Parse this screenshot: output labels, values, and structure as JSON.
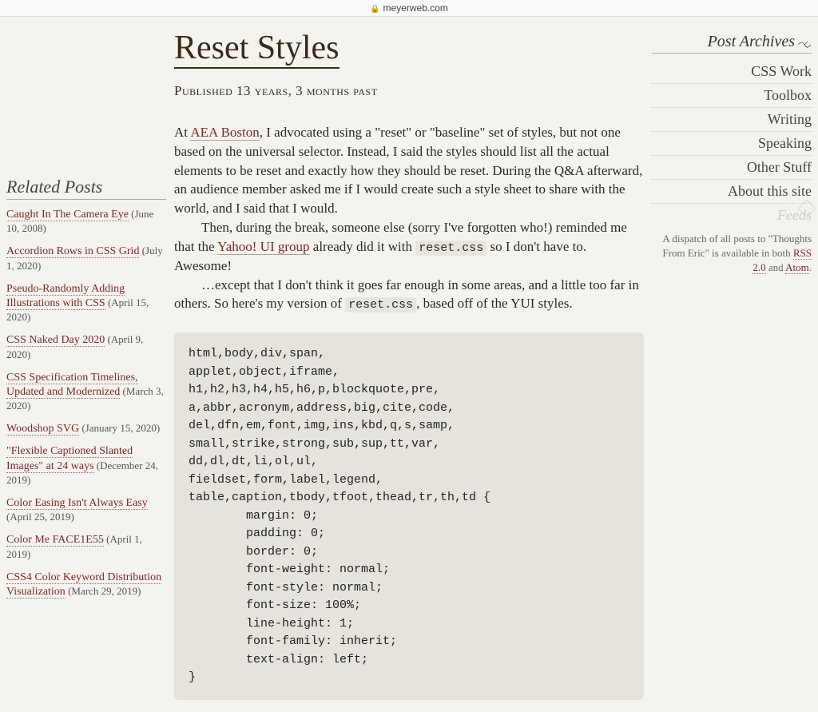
{
  "browser": {
    "host": "meyerweb.com"
  },
  "page": {
    "title": "Reset Styles",
    "published": "Published 13 years, 3 months past"
  },
  "body": {
    "p1_a": "At ",
    "p1_link": "AEA Boston",
    "p1_b": ", I advocated using a \"reset\" or \"baseline\" set of styles, but not one based on the universal selector.  Instead, I said the styles should list all the actual elements to be reset and exactly how they should be reset.  During the Q&A afterward, an audience member asked me if I would create such a style sheet to share with the world, and I said that I would.",
    "p2_a": "Then, during the break, someone else (sorry I've forgotten who!) reminded me that the ",
    "p2_link": "Yahoo! UI group",
    "p2_b": " already did it with ",
    "p2_code": "reset.css",
    "p2_c": " so I don't have to.  Awesome!",
    "p3_a": "…except that I don't think it goes far enough in some areas, and a little too far in others.  So here's my version of ",
    "p3_code": "reset.css",
    "p3_b": ", based off of the YUI styles."
  },
  "code": "html,body,div,span,\napplet,object,iframe,\nh1,h2,h3,h4,h5,h6,p,blockquote,pre,\na,abbr,acronym,address,big,cite,code,\ndel,dfn,em,font,img,ins,kbd,q,s,samp,\nsmall,strike,strong,sub,sup,tt,var,\ndd,dl,dt,li,ol,ul,\nfieldset,form,label,legend,\ntable,caption,tbody,tfoot,thead,tr,th,td {\n        margin: 0;\n        padding: 0;\n        border: 0;\n        font-weight: normal;\n        font-style: normal;\n        font-size: 100%;\n        line-height: 1;\n        font-family: inherit;\n        text-align: left;\n}",
  "related": {
    "heading": "Related Posts",
    "items": [
      {
        "title": "Caught In The Camera Eye",
        "date": "(June 10, 2008)"
      },
      {
        "title": "Accordion Rows in CSS Grid",
        "date": "(July 1, 2020)"
      },
      {
        "title": "Pseudo-Randomly Adding Illustrations with CSS",
        "date": "(April 15, 2020)"
      },
      {
        "title": "CSS Naked Day 2020",
        "date": "(April 9, 2020)"
      },
      {
        "title": "CSS Specification Timelines, Updated and Modernized",
        "date": "(March 3, 2020)"
      },
      {
        "title": "Woodshop SVG",
        "date": "(January 15, 2020)"
      },
      {
        "title": "\"Flexible Captioned Slanted Images\" at 24 ways",
        "date": "(December 24, 2019)"
      },
      {
        "title": "Color Easing Isn't Always Easy",
        "date": "(April 25, 2019)"
      },
      {
        "title": "Color Me FACE1E55",
        "date": "(April 1, 2019)"
      },
      {
        "title": "CSS4 Color Keyword Distribution Visualization",
        "date": "(March 29, 2019)"
      }
    ]
  },
  "nav": {
    "heading": "Post Archives",
    "items": [
      "CSS Work",
      "Toolbox",
      "Writing",
      "Speaking",
      "Other Stuff",
      "About this site"
    ],
    "feeds_label": "Feeds",
    "dispatch_a": "A dispatch of all posts to \"Thoughts From Eric\" is available in both ",
    "rss": "RSS 2.0",
    "dispatch_b": " and ",
    "atom": "Atom",
    "dispatch_c": "."
  }
}
